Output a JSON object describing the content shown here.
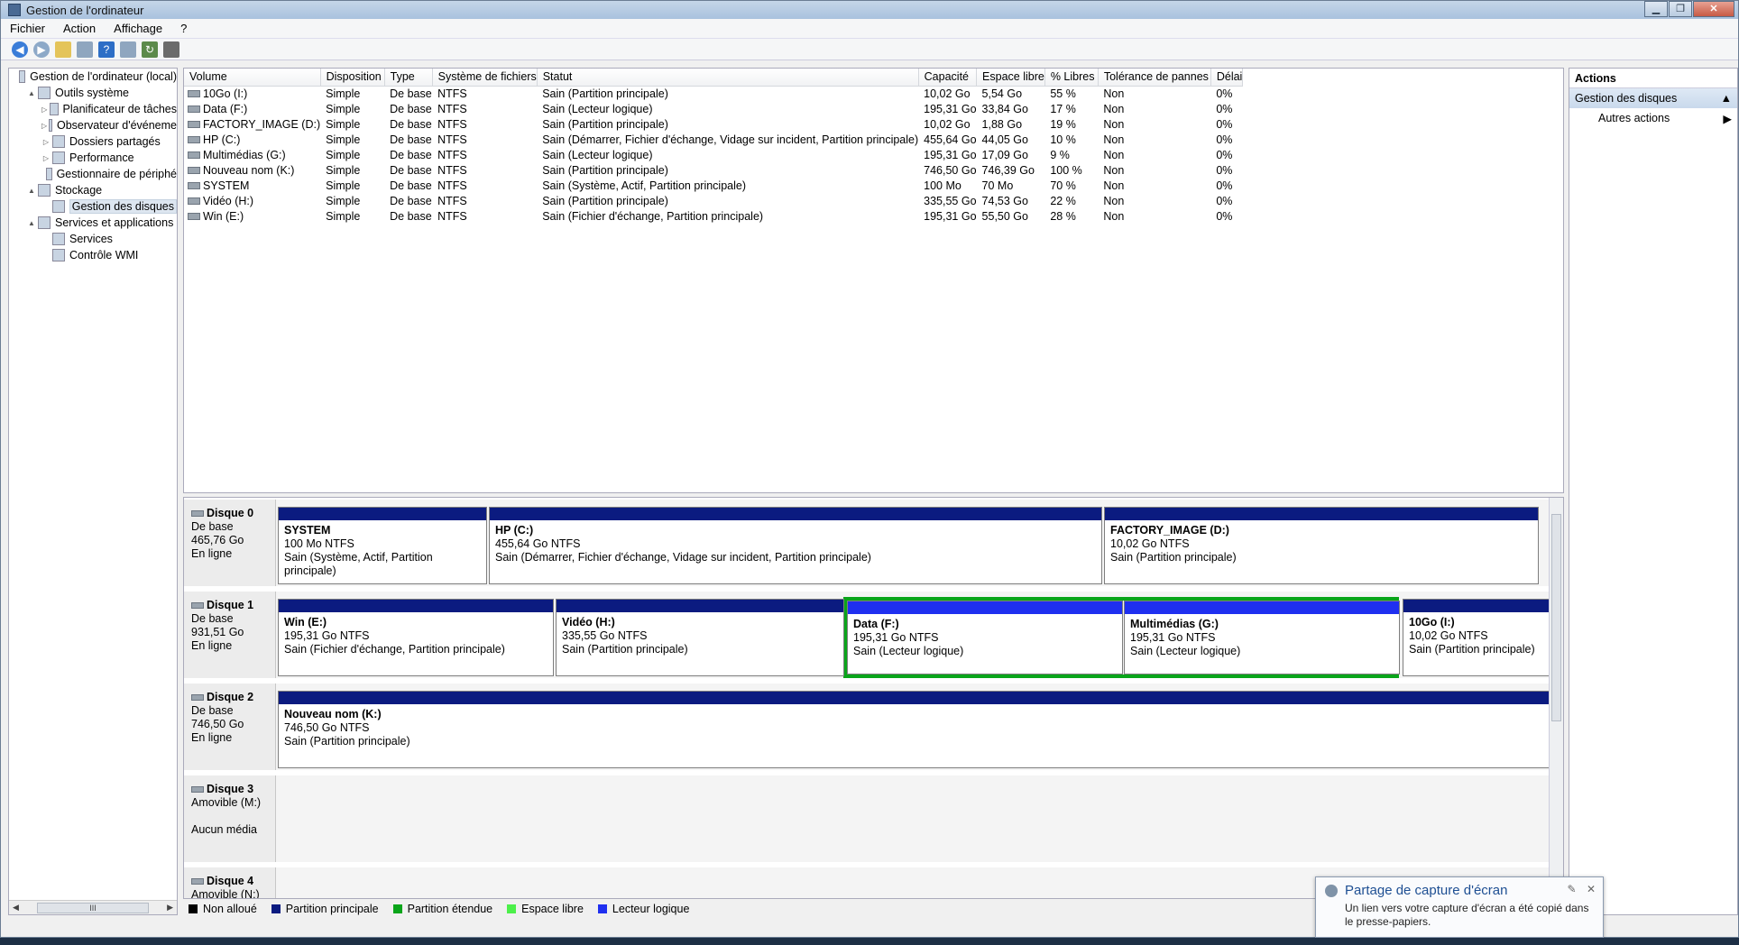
{
  "window": {
    "title": "Gestion de l'ordinateur"
  },
  "menu": [
    "Fichier",
    "Action",
    "Affichage",
    "?"
  ],
  "tree": [
    {
      "label": "Gestion de l'ordinateur (local)",
      "level": 0,
      "exp": "",
      "icon": "computer-icon"
    },
    {
      "label": "Outils système",
      "level": 1,
      "exp": "▲",
      "icon": "tools-icon"
    },
    {
      "label": "Planificateur de tâches",
      "level": 2,
      "exp": "▷",
      "icon": "clock-icon"
    },
    {
      "label": "Observateur d'événeme",
      "level": 2,
      "exp": "▷",
      "icon": "event-viewer-icon"
    },
    {
      "label": "Dossiers partagés",
      "level": 2,
      "exp": "▷",
      "icon": "shared-folder-icon"
    },
    {
      "label": "Performance",
      "level": 2,
      "exp": "▷",
      "icon": "performance-icon"
    },
    {
      "label": "Gestionnaire de périphé",
      "level": 2,
      "exp": "",
      "icon": "device-manager-icon"
    },
    {
      "label": "Stockage",
      "level": 1,
      "exp": "▲",
      "icon": "storage-icon"
    },
    {
      "label": "Gestion des disques",
      "level": 2,
      "exp": "",
      "icon": "disk-management-icon",
      "selected": true
    },
    {
      "label": "Services et applications",
      "level": 1,
      "exp": "▲",
      "icon": "services-apps-icon"
    },
    {
      "label": "Services",
      "level": 2,
      "exp": "",
      "icon": "services-icon"
    },
    {
      "label": "Contrôle WMI",
      "level": 2,
      "exp": "",
      "icon": "wmi-icon"
    }
  ],
  "tree_scroll_label": "III",
  "volumes": {
    "columns": [
      "Volume",
      "Disposition",
      "Type",
      "Système de fichiers",
      "Statut",
      "Capacité",
      "Espace libre",
      "% Libres",
      "Tolérance de pannes",
      "Délai"
    ],
    "rows": [
      [
        "10Go (I:)",
        "Simple",
        "De base",
        "NTFS",
        "Sain (Partition principale)",
        "10,02 Go",
        "5,54 Go",
        "55 %",
        "Non",
        "0%"
      ],
      [
        "Data (F:)",
        "Simple",
        "De base",
        "NTFS",
        "Sain (Lecteur logique)",
        "195,31 Go",
        "33,84 Go",
        "17 %",
        "Non",
        "0%"
      ],
      [
        "FACTORY_IMAGE (D:)",
        "Simple",
        "De base",
        "NTFS",
        "Sain (Partition principale)",
        "10,02 Go",
        "1,88 Go",
        "19 %",
        "Non",
        "0%"
      ],
      [
        "HP (C:)",
        "Simple",
        "De base",
        "NTFS",
        "Sain (Démarrer, Fichier d'échange, Vidage sur incident, Partition principale)",
        "455,64 Go",
        "44,05 Go",
        "10 %",
        "Non",
        "0%"
      ],
      [
        "Multimédias (G:)",
        "Simple",
        "De base",
        "NTFS",
        "Sain (Lecteur logique)",
        "195,31 Go",
        "17,09 Go",
        "9 %",
        "Non",
        "0%"
      ],
      [
        "Nouveau nom (K:)",
        "Simple",
        "De base",
        "NTFS",
        "Sain (Partition principale)",
        "746,50 Go",
        "746,39 Go",
        "100 %",
        "Non",
        "0%"
      ],
      [
        "SYSTEM",
        "Simple",
        "De base",
        "NTFS",
        "Sain (Système, Actif, Partition principale)",
        "100 Mo",
        "70 Mo",
        "70 %",
        "Non",
        "0%"
      ],
      [
        "Vidéo (H:)",
        "Simple",
        "De base",
        "NTFS",
        "Sain (Partition principale)",
        "335,55 Go",
        "74,53 Go",
        "22 %",
        "Non",
        "0%"
      ],
      [
        "Win (E:)",
        "Simple",
        "De base",
        "NTFS",
        "Sain (Fichier d'échange, Partition principale)",
        "195,31 Go",
        "55,50 Go",
        "28 %",
        "Non",
        "0%"
      ]
    ]
  },
  "disks": [
    {
      "name": "Disque 0",
      "line1": "De base",
      "line2": "465,76 Go",
      "line3": "En ligne",
      "partitions": [
        {
          "name": "SYSTEM",
          "size": "100 Mo NTFS",
          "status": "Sain (Système, Actif, Partition principale)",
          "kind": "primary"
        },
        {
          "name": "HP  (C:)",
          "size": "455,64 Go NTFS",
          "status": "Sain (Démarrer, Fichier d'échange, Vidage sur incident, Partition principale)",
          "kind": "primary"
        },
        {
          "name": "FACTORY_IMAGE  (D:)",
          "size": "10,02 Go NTFS",
          "status": "Sain (Partition principale)",
          "kind": "primary"
        }
      ]
    },
    {
      "name": "Disque 1",
      "line1": "De base",
      "line2": "931,51 Go",
      "line3": "En ligne",
      "partitions": [
        {
          "name": "Win  (E:)",
          "size": "195,31 Go NTFS",
          "status": "Sain (Fichier d'échange, Partition principale)",
          "kind": "primary"
        },
        {
          "name": "Vidéo  (H:)",
          "size": "335,55 Go NTFS",
          "status": "Sain (Partition principale)",
          "kind": "primary"
        },
        {
          "name": "Data  (F:)",
          "size": "195,31 Go NTFS",
          "status": "Sain (Lecteur logique)",
          "kind": "logical"
        },
        {
          "name": "Multimédias  (G:)",
          "size": "195,31 Go NTFS",
          "status": "Sain (Lecteur logique)",
          "kind": "logical"
        },
        {
          "name": "10Go  (I:)",
          "size": "10,02 Go NTFS",
          "status": "Sain (Partition principale)",
          "kind": "primary"
        }
      ]
    },
    {
      "name": "Disque 2",
      "line1": "De base",
      "line2": "746,50 Go",
      "line3": "En ligne",
      "partitions": [
        {
          "name": "Nouveau nom  (K:)",
          "size": "746,50 Go NTFS",
          "status": "Sain (Partition principale)",
          "kind": "primary"
        }
      ]
    },
    {
      "name": "Disque 3",
      "line1": "Amovible (M:)",
      "line2": "",
      "line3": "Aucun média",
      "partitions": []
    },
    {
      "name": "Disque 4",
      "line1": "Amovible (N:)",
      "line2": "",
      "line3": "",
      "partitions": []
    }
  ],
  "legend": [
    {
      "label": "Non alloué",
      "color": "#000000"
    },
    {
      "label": "Partition principale",
      "color": "#0b1b80"
    },
    {
      "label": "Partition étendue",
      "color": "#0aa51a"
    },
    {
      "label": "Espace libre",
      "color": "#4cf04a"
    },
    {
      "label": "Lecteur logique",
      "color": "#1f2ff0"
    }
  ],
  "actions": {
    "header": "Actions",
    "section": "Gestion des disques",
    "items": [
      "Autres actions"
    ]
  },
  "toast": {
    "title": "Partage de capture d'écran",
    "body": "Un lien vers votre capture d'écran a été copié dans le presse-papiers."
  }
}
